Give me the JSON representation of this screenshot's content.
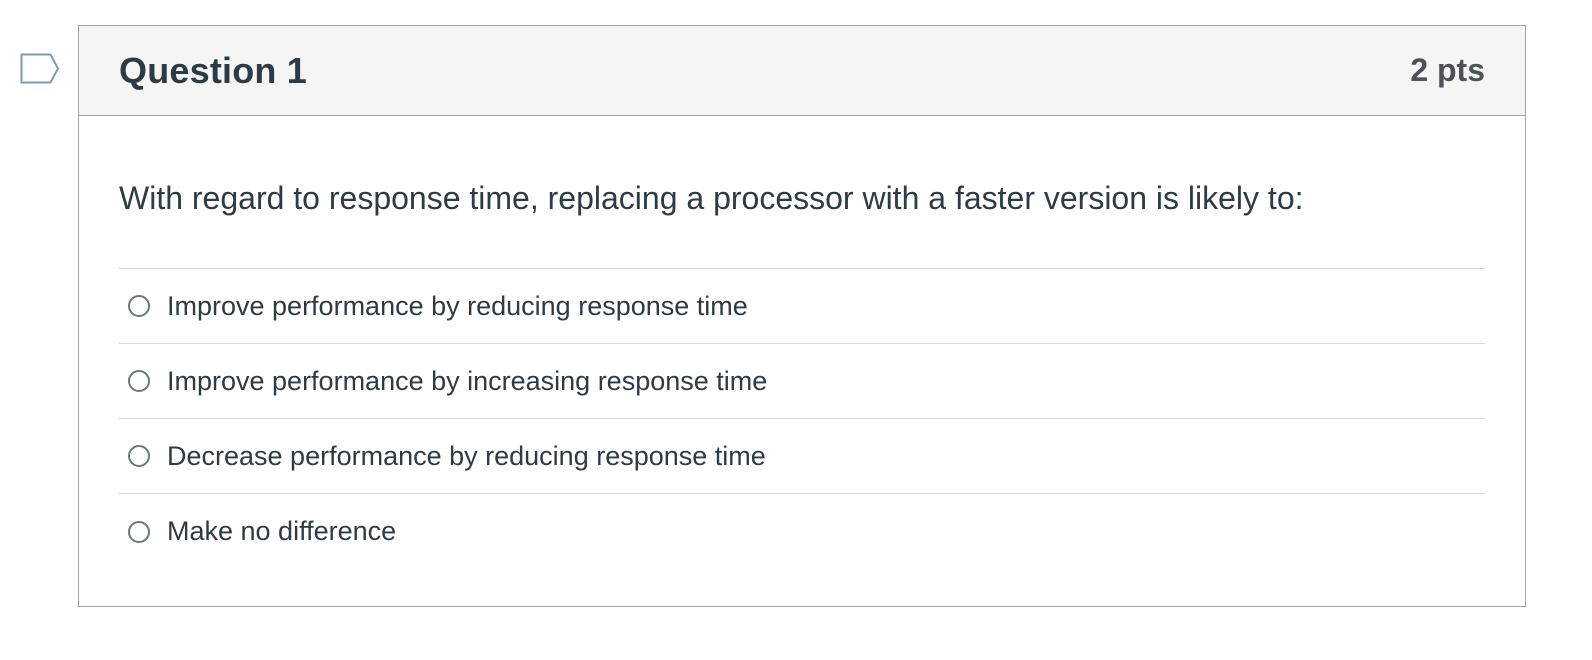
{
  "question": {
    "title": "Question 1",
    "points": "2 pts",
    "text": "With regard to response time, replacing a processor with a faster version is likely to:",
    "answers": [
      {
        "label": "Improve performance by reducing response time",
        "selected": false
      },
      {
        "label": "Improve performance by increasing response time",
        "selected": false
      },
      {
        "label": "Decrease performance by reducing response time",
        "selected": false
      },
      {
        "label": "Make no difference",
        "selected": false
      }
    ]
  },
  "icons": {
    "flag": "flag-question-icon",
    "radio": "radio-button-icon"
  },
  "colors": {
    "header_bg": "#f5f5f5",
    "border": "#a0a5a8",
    "flag_stroke": "#7b9cb0",
    "text": "#2d3b45"
  }
}
